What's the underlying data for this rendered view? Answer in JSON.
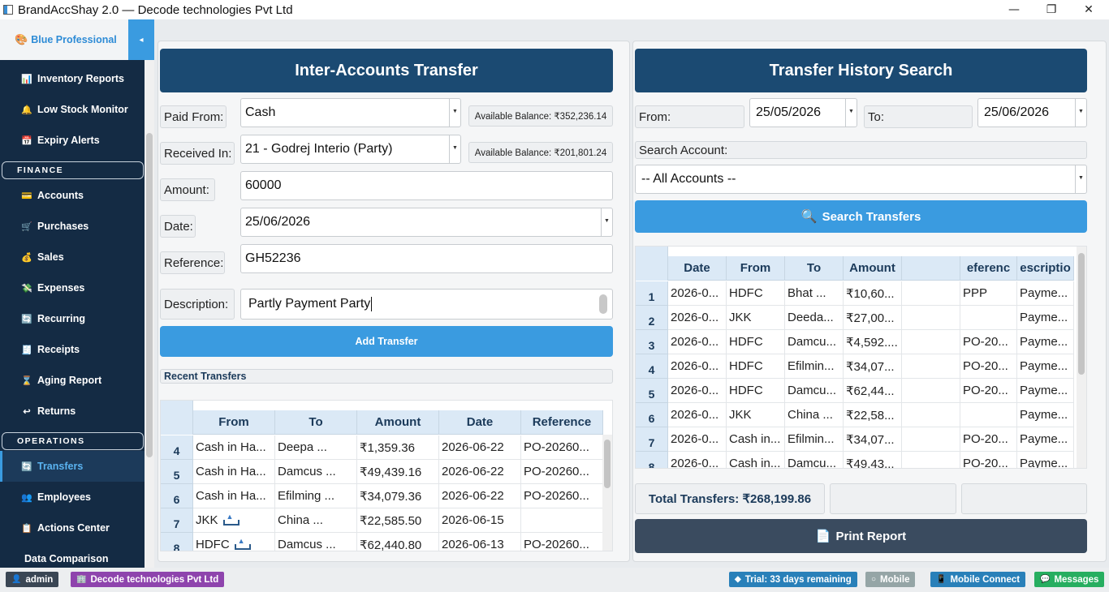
{
  "window": {
    "title": "BrandAccShay 2.0  —  Decode technologies Pvt Ltd",
    "minimize": "—",
    "maximize": "❐",
    "close": "✕"
  },
  "sidebar": {
    "theme_label": "Blue Professional",
    "toggle": "◂",
    "items": [
      {
        "label": "Inventory Reports",
        "icon": "📊"
      },
      {
        "label": "Low Stock Monitor",
        "icon": "🔔"
      },
      {
        "label": "Expiry Alerts",
        "icon": "📅"
      },
      {
        "label": "Accounts",
        "icon": "💳"
      },
      {
        "label": "Purchases",
        "icon": "🛒"
      },
      {
        "label": "Sales",
        "icon": "💰"
      },
      {
        "label": "Expenses",
        "icon": "💸"
      },
      {
        "label": "Recurring",
        "icon": "🔄"
      },
      {
        "label": "Receipts",
        "icon": "🧾"
      },
      {
        "label": "Aging Report",
        "icon": "⌛"
      },
      {
        "label": "Returns",
        "icon": "↩"
      },
      {
        "label": "Transfers",
        "icon": "🔄"
      },
      {
        "label": "Employees",
        "icon": "👥"
      },
      {
        "label": "Actions Center",
        "icon": "📋"
      },
      {
        "label": "Data Comparison",
        "icon": ""
      }
    ],
    "sections": {
      "finance": "FINANCE",
      "operations": "OPERATIONS"
    }
  },
  "transfer_form": {
    "title": "Inter-Accounts Transfer",
    "paid_from_label": "Paid From:",
    "paid_from_value": "Cash",
    "paid_from_balance": "Available Balance: ₹352,236.14",
    "received_in_label": "Received In:",
    "received_in_value": "21 - Godrej Interio (Party)",
    "received_in_balance": "Available Balance: ₹201,801.24",
    "amount_label": "Amount:",
    "amount_value": "60000",
    "date_label": "Date:",
    "date_value": "25/06/2026",
    "reference_label": "Reference:",
    "reference_value": "GH52236",
    "description_label": "Description:",
    "description_value": "Partly Payment  Party",
    "add_button": "Add Transfer",
    "recent_label": "Recent Transfers"
  },
  "recent_table": {
    "columns": [
      "From",
      "To",
      "Amount",
      "Date",
      "Reference"
    ],
    "rows": [
      {
        "num": "4",
        "from": "Cash in Ha...",
        "to": "Deepa ...",
        "amount": "₹1,359.36",
        "date": "2026-06-22",
        "ref": "PO-20260..."
      },
      {
        "num": "5",
        "from": "Cash in Ha...",
        "to": "Damcus ...",
        "amount": "₹49,439.16",
        "date": "2026-06-22",
        "ref": "PO-20260..."
      },
      {
        "num": "6",
        "from": "Cash in Ha...",
        "to": "Efilming ...",
        "amount": "₹34,079.36",
        "date": "2026-06-22",
        "ref": "PO-20260..."
      },
      {
        "num": "7",
        "from": "JKK",
        "to": "China ...",
        "amount": "₹22,585.50",
        "date": "2026-06-15",
        "ref": ""
      },
      {
        "num": "8",
        "from": "HDFC",
        "to": "Damcus ...",
        "amount": "₹62,440.80",
        "date": "2026-06-13",
        "ref": "PO-20260..."
      }
    ]
  },
  "history": {
    "title": "Transfer History Search",
    "from_label": "From:",
    "from_date": "25/05/2026",
    "to_label": "To:",
    "to_date": "25/06/2026",
    "search_account_label": "Search Account:",
    "account_value": "-- All Accounts --",
    "search_button": "Search Transfers",
    "total": "Total Transfers: ₹268,199.86",
    "print_button": "Print Report"
  },
  "history_table": {
    "columns": [
      "Date",
      "From",
      "To",
      "Amount",
      "",
      "eferenc",
      "escriptio"
    ],
    "rows": [
      {
        "num": "1",
        "date": "2026-0...",
        "from": "HDFC",
        "to": "Bhat ...",
        "amount": "₹10,60...",
        "blank": "",
        "ref": "PPP",
        "desc": "Payme..."
      },
      {
        "num": "2",
        "date": "2026-0...",
        "from": "JKK",
        "to": "Deeda...",
        "amount": "₹27,00...",
        "blank": "",
        "ref": "",
        "desc": "Payme..."
      },
      {
        "num": "3",
        "date": "2026-0...",
        "from": "HDFC",
        "to": "Damcu...",
        "amount": "₹4,592....",
        "blank": "",
        "ref": "PO-20...",
        "desc": "Payme..."
      },
      {
        "num": "4",
        "date": "2026-0...",
        "from": "HDFC",
        "to": "Efilmin...",
        "amount": "₹34,07...",
        "blank": "",
        "ref": "PO-20...",
        "desc": "Payme..."
      },
      {
        "num": "5",
        "date": "2026-0...",
        "from": "HDFC",
        "to": "Damcu...",
        "amount": "₹62,44...",
        "blank": "",
        "ref": "PO-20...",
        "desc": "Payme..."
      },
      {
        "num": "6",
        "date": "2026-0...",
        "from": "JKK",
        "to": "China ...",
        "amount": "₹22,58...",
        "blank": "",
        "ref": "",
        "desc": "Payme..."
      },
      {
        "num": "7",
        "date": "2026-0...",
        "from": "Cash in...",
        "to": "Efilmin...",
        "amount": "₹34,07...",
        "blank": "",
        "ref": "PO-20...",
        "desc": "Payme..."
      },
      {
        "num": "8",
        "date": "2026-0...",
        "from": "Cash in...",
        "to": "Damcu...",
        "amount": "₹49,43...",
        "blank": "",
        "ref": "PO-20...",
        "desc": "Payme..."
      }
    ]
  },
  "statusbar": {
    "user": "admin",
    "company": "Decode technologies Pvt Ltd",
    "trial": "Trial: 33 days remaining",
    "mobile": "Mobile",
    "mobile_connect": "Mobile Connect",
    "messages": "Messages"
  },
  "colors": {
    "header": "#1b4a72",
    "accent": "#3a9be0",
    "sidebar": "#142b44",
    "print": "#3a4b5f"
  }
}
